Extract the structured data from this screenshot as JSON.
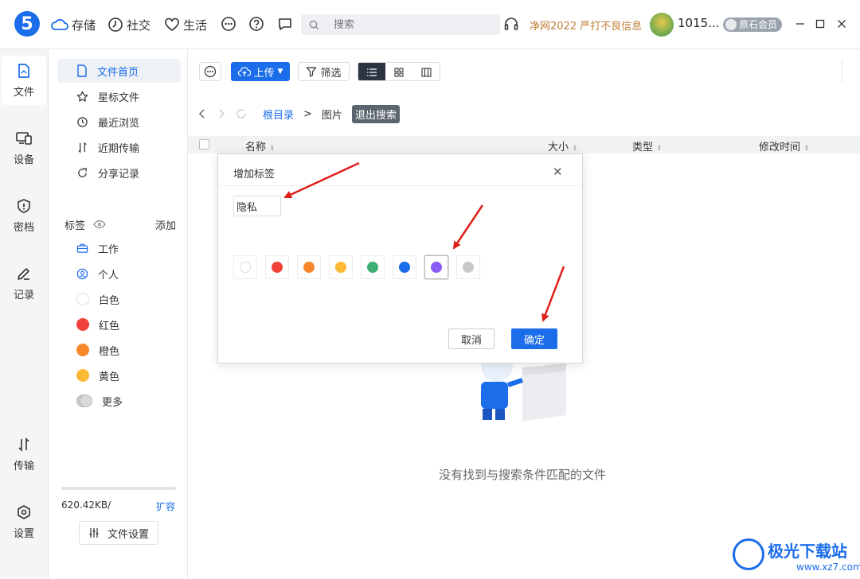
{
  "titlebar": {
    "logo": "5",
    "nav": [
      {
        "label": "存储",
        "icon": "cloud-icon"
      },
      {
        "label": "社交",
        "icon": "clock-icon"
      },
      {
        "label": "生活",
        "icon": "heart-icon"
      }
    ],
    "search_placeholder": "搜索",
    "promo": "净网2022 严打不良信息",
    "username": "1015...",
    "vip_label": "原石会员"
  },
  "rail": [
    {
      "label": "文件",
      "icon": "file-icon",
      "active": true
    },
    {
      "label": "设备",
      "icon": "device-icon"
    },
    {
      "label": "密档",
      "icon": "shield-icon"
    },
    {
      "label": "记录",
      "icon": "pen-icon"
    },
    {
      "label": "传输",
      "icon": "transfer-icon"
    },
    {
      "label": "设置",
      "icon": "gear-icon"
    }
  ],
  "sidebar": {
    "items": [
      {
        "label": "文件首页",
        "icon": "doc-icon",
        "active": true
      },
      {
        "label": "星标文件",
        "icon": "star-icon"
      },
      {
        "label": "最近浏览",
        "icon": "history-icon"
      },
      {
        "label": "近期传输",
        "icon": "transfer-icon"
      },
      {
        "label": "分享记录",
        "icon": "share-icon"
      }
    ],
    "tags_title": "标签",
    "tags_add": "添加",
    "tags": [
      {
        "label": "工作",
        "icon": "briefcase-icon",
        "color": "#1b6dea"
      },
      {
        "label": "个人",
        "icon": "person-icon",
        "color": "#1b6dea"
      },
      {
        "label": "白色",
        "color": "#ffffff"
      },
      {
        "label": "红色",
        "color": "#f0413a"
      },
      {
        "label": "橙色",
        "color": "#f7872a"
      },
      {
        "label": "黄色",
        "color": "#fbb832"
      },
      {
        "label": "更多",
        "color": "#c8c8c8"
      }
    ],
    "storage_text": "620.42KB/",
    "storage_expand": "扩容",
    "file_settings": "文件设置"
  },
  "toolbar": {
    "upload": "上传",
    "filter": "筛选"
  },
  "breadcrumb": {
    "root": "根目录",
    "separator": ">",
    "current": "图片",
    "exit_search": "退出搜索"
  },
  "table": {
    "columns": [
      "名称",
      "大小",
      "类型",
      "修改时间"
    ]
  },
  "empty_text": "没有找到与搜索条件匹配的文件",
  "dialog": {
    "title": "增加标签",
    "input_value": "隐私",
    "swatches": [
      "#ffffff",
      "#f0413a",
      "#f7872a",
      "#fbb832",
      "#3dae76",
      "#1b6dea",
      "#8b5cf6",
      "#c8c8c8"
    ],
    "selected_index": 6,
    "cancel": "取消",
    "ok": "确定"
  },
  "watermark": {
    "title": "极光下载站",
    "url": "www.xz7.com"
  }
}
